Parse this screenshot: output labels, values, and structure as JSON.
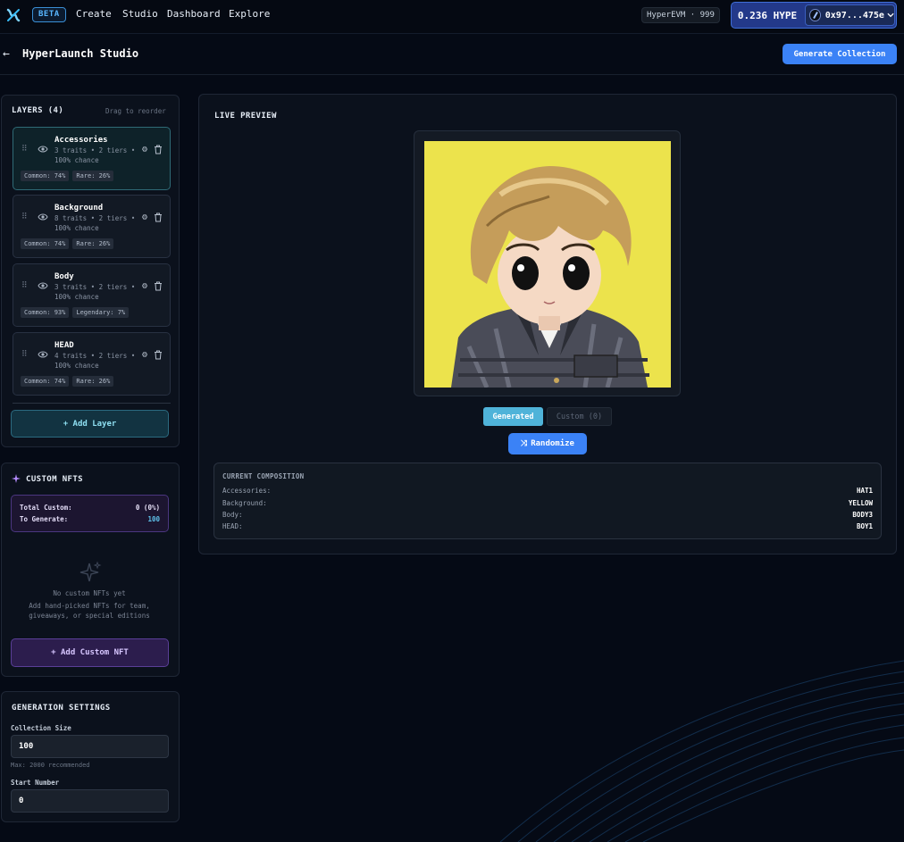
{
  "nav": {
    "beta": "BETA",
    "links": [
      "Create",
      "Studio",
      "Dashboard",
      "Explore"
    ],
    "chain": "HyperEVM · 999",
    "balance": "0.236 HYPE",
    "address": "0x97...475e"
  },
  "header": {
    "back_icon": "←",
    "title": "HyperLaunch Studio",
    "generate_label": "Generate Collection"
  },
  "layers": {
    "title": "LAYERS (4)",
    "hint": "Drag to reorder",
    "items": [
      {
        "name": "Accessories",
        "meta": "3 traits • 2 tiers •",
        "chance": "100% chance",
        "tags": [
          "Common: 74%",
          "Rare: 26%"
        ]
      },
      {
        "name": "Background",
        "meta": "8 traits • 2 tiers •",
        "chance": "100% chance",
        "tags": [
          "Common: 74%",
          "Rare: 26%"
        ]
      },
      {
        "name": "Body",
        "meta": "3 traits • 2 tiers •",
        "chance": "100% chance",
        "tags": [
          "Common: 93%",
          "Legendary: 7%"
        ]
      },
      {
        "name": "HEAD",
        "meta": "4 traits • 2 tiers •",
        "chance": "100% chance",
        "tags": [
          "Common: 74%",
          "Rare: 26%"
        ]
      }
    ],
    "add_label": "+ Add Layer"
  },
  "custom": {
    "title": "CUSTOM NFTS",
    "total_label": "Total Custom:",
    "total_value": "0 (0%)",
    "generate_label": "To Generate:",
    "generate_value": "100",
    "empty_title": "No custom NFTs yet",
    "empty_desc_1": "Add hand-picked NFTs for team,",
    "empty_desc_2": "giveaways, or special editions",
    "add_label": "+ Add Custom NFT"
  },
  "settings": {
    "title": "GENERATION SETTINGS",
    "size_label": "Collection Size",
    "size_value": "100",
    "size_hint": "Max: 2000 recommended",
    "start_label": "Start Number",
    "start_value": "0"
  },
  "preview": {
    "title": "LIVE PREVIEW",
    "tab_generated": "Generated",
    "tab_custom": "Custom (0)",
    "randomize_label": "Randomize",
    "composition_title": "CURRENT COMPOSITION",
    "composition": [
      {
        "key": "Accessories:",
        "value": "HAT1"
      },
      {
        "key": "Background:",
        "value": "YELLOW"
      },
      {
        "key": "Body:",
        "value": "BODY3"
      },
      {
        "key": "HEAD:",
        "value": "BOY1"
      }
    ]
  },
  "colors": {
    "accent": "#3b82f6",
    "background": "#050a15",
    "nft_background": "#ece34c",
    "custom_accent": "#5a3f97"
  }
}
